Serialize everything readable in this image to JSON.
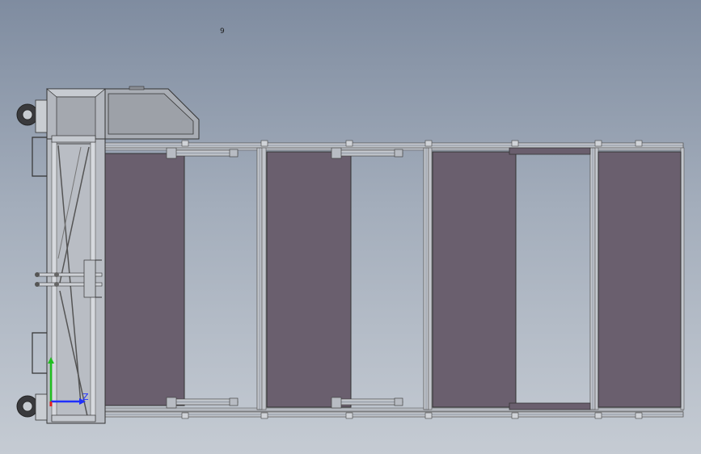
{
  "viewport": {
    "marker_label": "9"
  },
  "triad": {
    "z_label": "Z",
    "colors": {
      "x": "#e02020",
      "y": "#20c020",
      "z": "#2030ff"
    }
  },
  "model": {
    "panel_color": "#6a5f6e",
    "frame_color": "#c9ccd2",
    "panel_count": 4
  }
}
